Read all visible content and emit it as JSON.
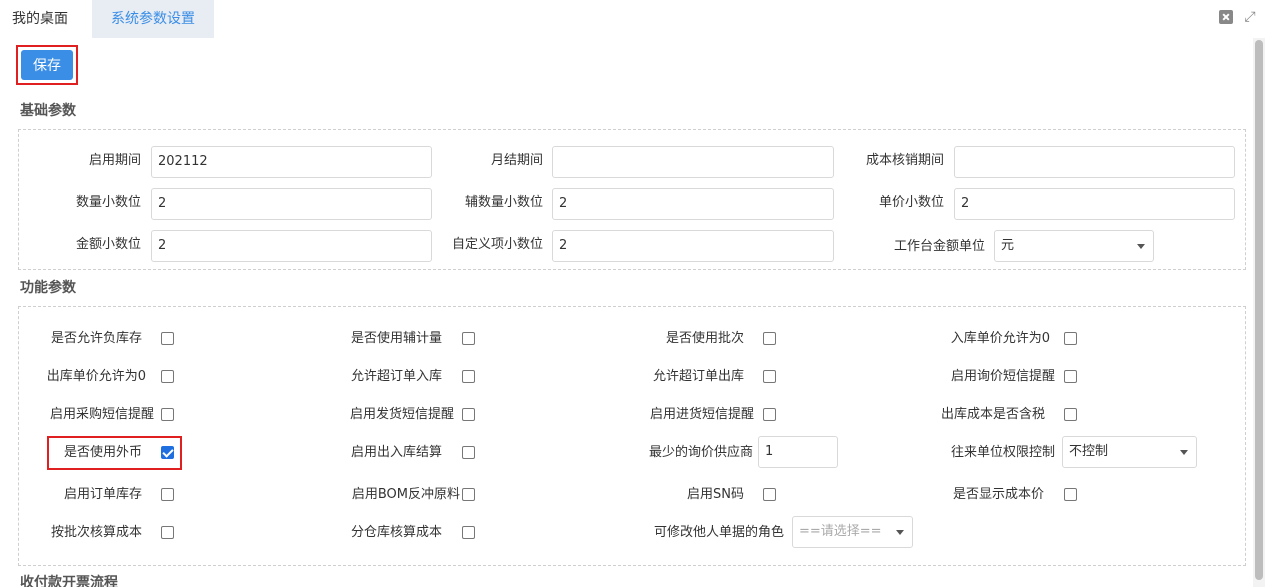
{
  "tabs": [
    {
      "label": "我的桌面"
    },
    {
      "label": "系统参数设置"
    }
  ],
  "toolbar": {
    "save_label": "保存"
  },
  "sections": {
    "basic": "基础参数",
    "function": "功能参数",
    "flow": "收付款开票流程"
  },
  "basic": {
    "start_period": {
      "label": "启用期间",
      "value": "202112"
    },
    "month_end": {
      "label": "月结期间",
      "value": ""
    },
    "cost_period": {
      "label": "成本核销期间",
      "value": ""
    },
    "qty_decimal": {
      "label": "数量小数位",
      "value": "2"
    },
    "aux_qty_decimal": {
      "label": "辅数量小数位",
      "value": "2"
    },
    "price_decimal": {
      "label": "单价小数位",
      "value": "2"
    },
    "amount_decimal": {
      "label": "金额小数位",
      "value": "2"
    },
    "custom_decimal": {
      "label": "自定义项小数位",
      "value": "2"
    },
    "workbench_unit": {
      "label": "工作台金额单位",
      "value": "元"
    }
  },
  "func": {
    "allow_negative_stock": {
      "label": "是否允许负库存",
      "checked": false
    },
    "use_aux_qty": {
      "label": "是否使用辅计量",
      "checked": false
    },
    "use_batch": {
      "label": "是否使用批次",
      "checked": false
    },
    "in_price_zero": {
      "label": "入库单价允许为0",
      "checked": false
    },
    "out_price_zero": {
      "label": "出库单价允许为0",
      "checked": false
    },
    "allow_over_in": {
      "label": "允许超订单入库",
      "checked": false
    },
    "allow_over_out": {
      "label": "允许超订单出库",
      "checked": false
    },
    "inquiry_sms": {
      "label": "启用询价短信提醒",
      "checked": false
    },
    "purchase_sms": {
      "label": "启用采购短信提醒",
      "checked": false
    },
    "ship_sms": {
      "label": "启用发货短信提醒",
      "checked": false
    },
    "receive_sms": {
      "label": "启用进货短信提醒",
      "checked": false
    },
    "out_cost_tax": {
      "label": "出库成本是否含税",
      "checked": false
    },
    "use_foreign_currency": {
      "label": "是否使用外币",
      "checked": true
    },
    "in_out_settle": {
      "label": "启用出入库结算",
      "checked": false
    },
    "min_inquiry_supplier": {
      "label": "最少的询价供应商",
      "value": "1"
    },
    "partner_permission": {
      "label": "往来单位权限控制",
      "value": "不控制"
    },
    "order_stock": {
      "label": "启用订单库存",
      "checked": false
    },
    "bom_backflush": {
      "label": "启用BOM反冲原料",
      "checked": false
    },
    "sn_code": {
      "label": "启用SN码",
      "checked": false
    },
    "show_cost": {
      "label": "是否显示成本价",
      "checked": false
    },
    "batch_cost": {
      "label": "按批次核算成本",
      "checked": false
    },
    "warehouse_cost": {
      "label": "分仓库核算成本",
      "checked": false
    },
    "edit_others_role": {
      "label": "可修改他人单据的角色",
      "value": "==请选择=="
    }
  },
  "colors": {
    "accent": "#3a8ee6",
    "highlight": "#e02020",
    "checked": "#1f6fe0"
  }
}
